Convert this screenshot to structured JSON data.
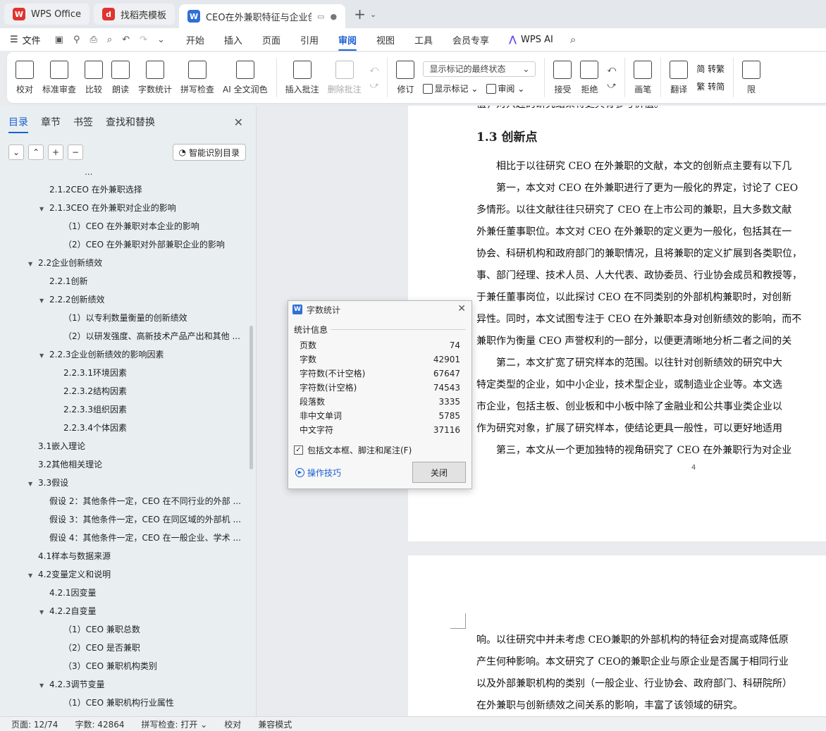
{
  "tabs": [
    {
      "label": "WPS Office",
      "logo": "W"
    },
    {
      "label": "找稻壳模板",
      "logo": "d"
    },
    {
      "label": "CEO在外兼职特征与企业创新",
      "logo": "W",
      "active": true
    }
  ],
  "menu": {
    "file": "文件",
    "items": [
      "开始",
      "插入",
      "页面",
      "引用",
      "审阅",
      "视图",
      "工具",
      "会员专享"
    ],
    "active": "审阅",
    "ai": "WPS AI"
  },
  "ribbon": {
    "proofread": "校对",
    "standard_review": "标准审查",
    "compare": "比较",
    "read_aloud": "朗读",
    "word_count": "字数统计",
    "spell_check": "拼写检查",
    "ai_polish": "AI 全文润色",
    "insert_comment": "插入批注",
    "delete_comment": "删除批注",
    "revise": "修订",
    "markup_select": "显示标记的最终状态",
    "show_markup": "显示标记",
    "review": "审阅",
    "accept": "接受",
    "reject": "拒绝",
    "pen": "画笔",
    "translate": "翻译",
    "to_traditional": "简 转繁",
    "to_simplified": "繁 转简",
    "cut_label": "限"
  },
  "leftpanel": {
    "tabs": [
      "目录",
      "章节",
      "书签",
      "查找和替换"
    ],
    "active_tab": "目录",
    "smart_toc": "智能识别目录",
    "toc_cut": "...",
    "toc": [
      {
        "label": "2.1.2CEO 在外兼职选择",
        "level": 2,
        "arrow": false
      },
      {
        "label": "2.1.3CEO 在外兼职对企业的影响",
        "level": 2,
        "arrow": true
      },
      {
        "label": "（1）CEO 在外兼职对本企业的影响",
        "level": 3,
        "arrow": false
      },
      {
        "label": "（2）CEO 在外兼职对外部兼职企业的影响",
        "level": 3,
        "arrow": false
      },
      {
        "label": "2.2企业创新绩效",
        "level": 1,
        "arrow": true
      },
      {
        "label": "2.2.1创新",
        "level": 2,
        "arrow": false
      },
      {
        "label": "2.2.2创新绩效",
        "level": 2,
        "arrow": true
      },
      {
        "label": "（1）以专利数量衡量的创新绩效",
        "level": 3,
        "arrow": false
      },
      {
        "label": "（2）以研发强度、高新技术产品产出和其他 ...",
        "level": 3,
        "arrow": false
      },
      {
        "label": "2.2.3企业创新绩效的影响因素",
        "level": 2,
        "arrow": true
      },
      {
        "label": "2.2.3.1环境因素",
        "level": 3,
        "arrow": false
      },
      {
        "label": "2.2.3.2结构因素",
        "level": 3,
        "arrow": false
      },
      {
        "label": "2.2.3.3组织因素",
        "level": 3,
        "arrow": false
      },
      {
        "label": "2.2.3.4个体因素",
        "level": 3,
        "arrow": false
      },
      {
        "label": "3.1嵌入理论",
        "level": 1,
        "arrow": false
      },
      {
        "label": "3.2其他相关理论",
        "level": 1,
        "arrow": false
      },
      {
        "label": "3.3假设",
        "level": 1,
        "arrow": true
      },
      {
        "label": "假设 2：其他条件一定，CEO 在不同行业的外部 ...",
        "level": 2,
        "arrow": false
      },
      {
        "label": "假设 3：其他条件一定，CEO 在同区域的外部机 ...",
        "level": 2,
        "arrow": false
      },
      {
        "label": "假设 4：其他条件一定，CEO 在一般企业、学术 ...",
        "level": 2,
        "arrow": false
      },
      {
        "label": "4.1样本与数据来源",
        "level": 1,
        "arrow": false
      },
      {
        "label": "4.2变量定义和说明",
        "level": 1,
        "arrow": true
      },
      {
        "label": "4.2.1因变量",
        "level": 2,
        "arrow": false
      },
      {
        "label": "4.2.2自变量",
        "level": 2,
        "arrow": true
      },
      {
        "label": "（1）CEO 兼职总数",
        "level": 3,
        "arrow": false
      },
      {
        "label": "（2）CEO 是否兼职",
        "level": 3,
        "arrow": false
      },
      {
        "label": "（3）CEO 兼职机构类别",
        "level": 3,
        "arrow": false
      },
      {
        "label": "4.2.3调节变量",
        "level": 2,
        "arrow": true
      },
      {
        "label": "（1）CEO 兼职机构行业属性",
        "level": 3,
        "arrow": false
      }
    ]
  },
  "document": {
    "top_cut": "值，对兴趣的研究结果将更具有参考价值。",
    "heading": "1.3  创新点",
    "page1_lines": [
      "　　相比于以往研究  CEO 在外兼职的文献，本文的创新点主要有以下几",
      "　　第一，本文对  CEO 在外兼职进行了更为一般化的界定，讨论了  CEO",
      "多情形。以往文献往往只研究了  CEO 在上市公司的兼职，且大多数文献",
      "外兼任董事职位。本文对  CEO 在外兼职的定义更为一般化，包括其在一",
      "协会、科研机构和政府部门的兼职情况，且将兼职的定义扩展到各类职位，",
      "事、部门经理、技术人员、人大代表、政协委员、行业协会成员和教授等，",
      "于兼任董事岗位，以此探讨  CEO 在不同类别的外部机构兼职时，对创新",
      "异性。同时，本文试图专注于  CEO 在外兼职本身对创新绩效的影响，而不",
      "兼职作为衡量  CEO 声誉权利的一部分，以便更清晰地分析二者之间的关",
      "　　第二，本文扩宽了研究样本的范围。以往针对创新绩效的研究中大",
      "特定类型的企业，如中小企业，技术型企业，或制造业企业等。本文选",
      "市企业，包括主板、创业板和中小板中除了金融业和公共事业类企业以",
      "作为研究对象，扩展了研究样本，使结论更具一般性，可以更好地适用",
      "　　第三，本文从一个更加独特的视角研究了  CEO 在外兼职行为对企业"
    ],
    "page_number": "4",
    "page2_lines": [
      "响。以往研究中并未考虑  CEO兼职的外部机构的特征会对提高或降低原",
      "产生何种影响。本文研究了  CEO的兼职企业与原企业是否属于相同行业",
      "以及外部兼职机构的类别（一般企业、行业协会、政府部门、科研院所）",
      "在外兼职与创新绩效之间关系的影响，丰富了该领域的研究。"
    ]
  },
  "dialog": {
    "title": "字数统计",
    "section": "统计信息",
    "stats": [
      {
        "label": "页数",
        "value": "74"
      },
      {
        "label": "字数",
        "value": "42901"
      },
      {
        "label": "字符数(不计空格)",
        "value": "67647"
      },
      {
        "label": "字符数(计空格)",
        "value": "74543"
      },
      {
        "label": "段落数",
        "value": "3335"
      },
      {
        "label": "非中文单词",
        "value": "5785"
      },
      {
        "label": "中文字符",
        "value": "37116"
      }
    ],
    "checkbox_label": "包括文本框、脚注和尾注(F)",
    "checkbox_checked": true,
    "tips": "操作技巧",
    "close": "关闭"
  },
  "status": {
    "page": "页面: 12/74",
    "words": "字数: 42864",
    "spell": "拼写检查: 打开 ⌄",
    "proof": "校对",
    "compat": "兼容模式"
  }
}
